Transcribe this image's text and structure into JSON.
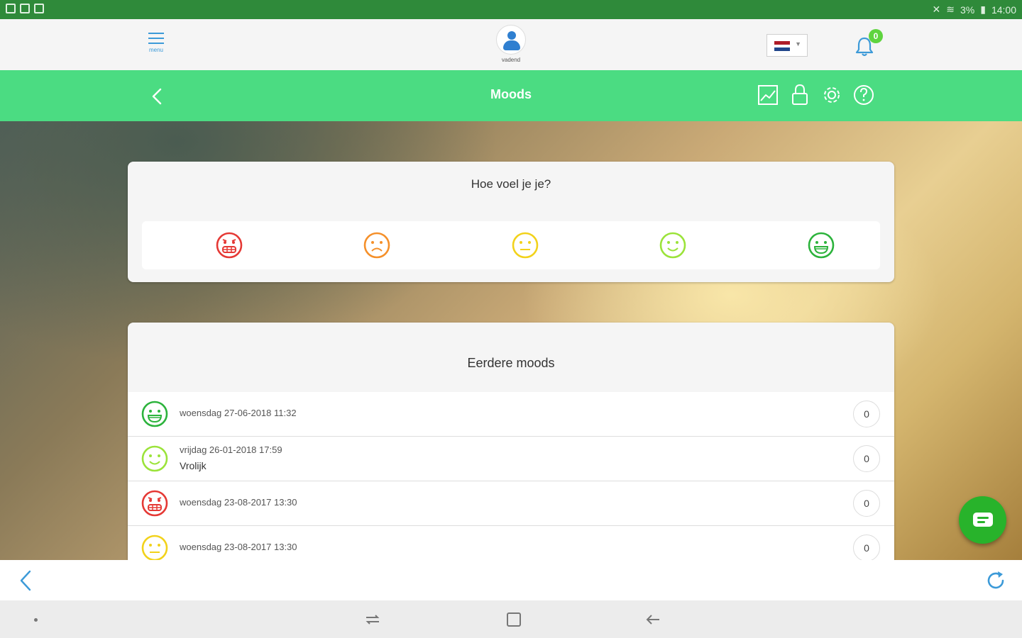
{
  "status_bar": {
    "time": "14:00",
    "battery": "3%"
  },
  "header": {
    "menu_label": "menu",
    "profile_label": "vadend",
    "notifications_count": "0",
    "language_flag": [
      "#ae1c28",
      "#ffffff",
      "#21468b"
    ]
  },
  "nav": {
    "title": "Moods"
  },
  "mood_picker": {
    "question": "Hoe voel je je?",
    "options": [
      {
        "icon": "angry-face-icon",
        "color": "#e53935"
      },
      {
        "icon": "sad-face-icon",
        "color": "#f5902a"
      },
      {
        "icon": "neutral-face-icon",
        "color": "#f2d21b"
      },
      {
        "icon": "smile-face-icon",
        "color": "#9be33a"
      },
      {
        "icon": "grin-face-icon",
        "color": "#2cb33c"
      }
    ]
  },
  "history": {
    "title": "Eerdere moods",
    "rows": [
      {
        "icon": "grin-face-icon",
        "color": "#2cb33c",
        "date": "woensdag 27-06-2018 11:32",
        "note": "",
        "count": "0"
      },
      {
        "icon": "smile-face-icon",
        "color": "#9be33a",
        "date": "vrijdag 26-01-2018 17:59",
        "note": "Vrolijk",
        "count": "0"
      },
      {
        "icon": "angry-face-icon",
        "color": "#e53935",
        "date": "woensdag 23-08-2017 13:30",
        "note": "",
        "count": "0"
      },
      {
        "icon": "neutral-face-icon",
        "color": "#f2d21b",
        "date": "woensdag 23-08-2017 13:30",
        "note": "",
        "count": "0"
      }
    ]
  },
  "colors": {
    "status_bar": "#2f8a3a",
    "nav_bar": "#4bdc82",
    "fab": "#28b32b",
    "link_blue": "#3c9ad8"
  }
}
